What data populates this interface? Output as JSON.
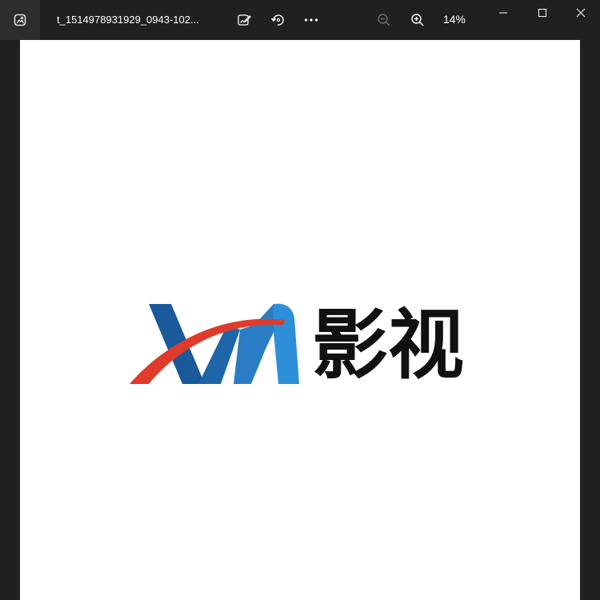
{
  "titlebar": {
    "file_name": "t_1514978931929_0943-102...",
    "zoom_level": "14%",
    "icons": {
      "app": "photo-viewer-icon",
      "edit": "edit-image-icon",
      "rotate": "rotate-icon",
      "more": "more-options-icon",
      "zoom_out": "zoom-out-icon",
      "zoom_in": "zoom-in-icon",
      "minimize": "minimize-icon",
      "maximize": "maximize-icon",
      "close": "close-icon"
    }
  },
  "image": {
    "logo_text": "影视",
    "colors": {
      "blue_dark": "#1a5a9a",
      "blue_light": "#2d8fd8",
      "red": "#e03a2a",
      "text": "#111111"
    }
  }
}
